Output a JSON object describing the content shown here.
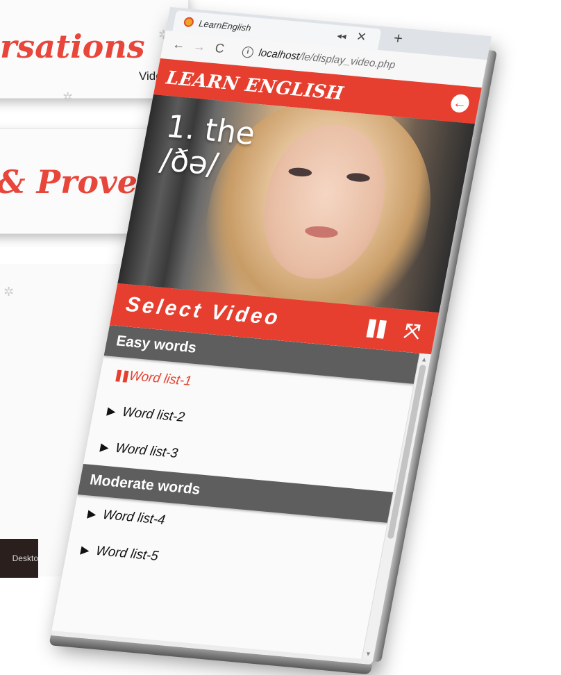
{
  "background": {
    "title1": "rsations",
    "subtitle1": "Vide",
    "title2": "& Prover",
    "taskbar_text": "Deskto"
  },
  "browser": {
    "tab_title": "LearnEnglish",
    "url_host": "localhost",
    "url_path": "/le/display_video.php"
  },
  "app": {
    "title": "LEARN ENGLISH"
  },
  "video": {
    "word_line1": "1. the",
    "word_line2": "/ðə/"
  },
  "player": {
    "select_label": "Select Video"
  },
  "categories": [
    {
      "name": "Easy words",
      "items": [
        {
          "label": "Word list-1",
          "state": "playing"
        },
        {
          "label": "Word list-2",
          "state": "idle"
        },
        {
          "label": "Word list-3",
          "state": "idle"
        }
      ]
    },
    {
      "name": "Moderate words",
      "items": [
        {
          "label": "Word list-4",
          "state": "idle"
        },
        {
          "label": "Word list-5",
          "state": "idle"
        }
      ]
    }
  ],
  "colors": {
    "accent": "#e63f2f",
    "category_bg": "#5e5e5e"
  },
  "icons": {
    "back": "arrow-left-circle-icon",
    "pause": "pause-icon",
    "expand": "expand-icon",
    "play": "play-icon"
  }
}
